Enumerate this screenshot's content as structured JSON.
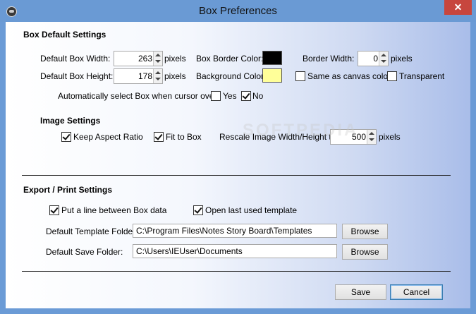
{
  "window": {
    "title": "Box Preferences",
    "close_glyph": "✕"
  },
  "box_default": {
    "heading": "Box Default Settings",
    "width_label": "Default Box Width:",
    "width_value": "263",
    "height_label": "Default Box Height:",
    "height_value": "178",
    "pixels": "pixels",
    "border_color_label": "Box Border Color:",
    "border_color": "#000000",
    "background_color_label": "Background Color:",
    "background_color": "#ffff99",
    "border_width_label": "Border Width:",
    "border_width_value": "0",
    "same_as_canvas_label": "Same as canvas color",
    "same_as_canvas_checked": false,
    "transparent_label": "Transparent",
    "transparent_checked": false,
    "auto_select_label": "Automatically select Box when cursor over:",
    "yes_label": "Yes",
    "yes_checked": false,
    "no_label": "No",
    "no_checked": true
  },
  "image_settings": {
    "heading": "Image Settings",
    "keep_aspect_label": "Keep Aspect Ratio",
    "keep_aspect_checked": true,
    "fit_to_box_label": "Fit to Box",
    "fit_to_box_checked": true,
    "rescale_label": "Rescale Image Width/Height to:",
    "rescale_value": "500",
    "pixels": "pixels"
  },
  "watermark": "SOFTPEDIA",
  "export_print": {
    "heading": "Export / Print Settings",
    "line_between_label": "Put a line between Box data",
    "line_between_checked": true,
    "open_last_label": "Open last used template",
    "open_last_checked": true,
    "template_folder_label": "Default Template Folder:",
    "template_folder_value": "C:\\Program Files\\Notes Story Board\\Templates",
    "save_folder_label": "Default Save Folder:",
    "save_folder_value": "C:\\Users\\IEUser\\Documents",
    "browse_label": "Browse"
  },
  "footer": {
    "save_label": "Save",
    "cancel_label": "Cancel"
  }
}
